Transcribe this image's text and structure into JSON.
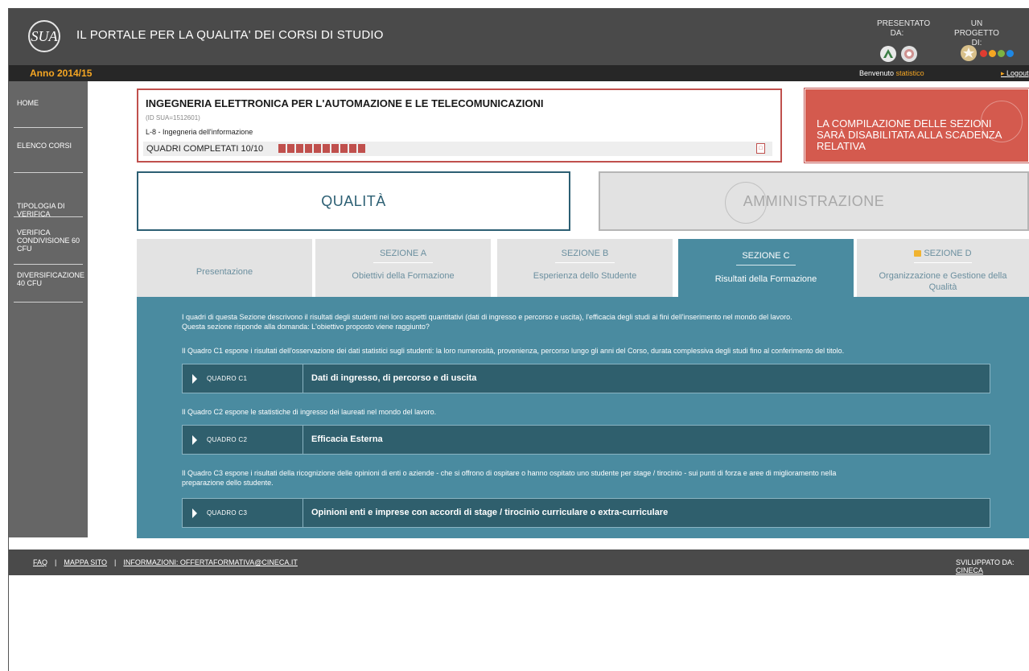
{
  "header": {
    "logo_text": "SUA",
    "title": "IL PORTALE PER LA QUALITA' DEI CORSI DI STUDIO",
    "presented_by": "PRESENTATO DA:",
    "project_of": "UN PROGETTO DI:",
    "anvur_label": "anvur"
  },
  "yearbar": {
    "year": "Anno 2014/15",
    "welcome": "Benvenuto",
    "user": "statistico",
    "logout": "Logout",
    "logout_arrow": "▸"
  },
  "sidebar": {
    "items": [
      {
        "label": "HOME"
      },
      {
        "label": "ELENCO CORSI"
      },
      {
        "label": "TIPOLOGIA DI VERIFICA"
      },
      {
        "label": "VERIFICA CONDIVISIONE 60 CFU"
      },
      {
        "label": "DIVERSIFICAZIONE 40 CFU"
      }
    ]
  },
  "course": {
    "title": "INGEGNERIA ELETTRONICA PER L'AUTOMAZIONE E LE TELECOMUNICAZIONI",
    "id": "(ID SUA=1512601)",
    "class": "L-8 - Ingegneria dell'informazione",
    "quadri": "QUADRI COMPLETATI 10/10",
    "quadri_completed": 10,
    "quadri_total": 10,
    "pdf_icon": "pdf-icon"
  },
  "warning": {
    "text": "LA COMPILAZIONE DELLE SEZIONI SARÀ DISABILITATA ALLA SCADENZA RELATIVA"
  },
  "big_tabs": {
    "qualita": "QUALITÀ",
    "amministrazione": "AMMINISTRAZIONE"
  },
  "section_tabs": [
    {
      "head": "",
      "sub": "Presentazione"
    },
    {
      "head": "SEZIONE A",
      "sub": "Obiettivi della Formazione"
    },
    {
      "head": "SEZIONE B",
      "sub": "Esperienza dello Studente"
    },
    {
      "head": "SEZIONE C",
      "sub": "Risultati della Formazione"
    },
    {
      "head": "SEZIONE D",
      "sub": "Organizzazione e Gestione della Qualità"
    }
  ],
  "content": {
    "intro_1": "I quadri di questa Sezione descrivono il risultati degli studenti nei loro aspetti quantitativi (dati di ingresso e percorso e uscita), l'efficacia degli studi ai fini dell'inserimento nel mondo del lavoro.",
    "intro_2": "Questa sezione risponde alla domanda: L'obiettivo proposto viene raggiunto?",
    "c1_desc": "Il Quadro C1 espone i risultati dell'osservazione dei dati statistici sugli studenti: la loro numerosità, provenienza, percorso lungo gli anni del Corso, durata complessiva degli studi fino al conferimento del titolo.",
    "c1_code": "QUADRO C1",
    "c1_title": "Dati di ingresso, di percorso e di uscita",
    "c2_desc": "Il Quadro C2 espone le statistiche di ingresso dei laureati nel mondo del lavoro.",
    "c2_code": "QUADRO C2",
    "c2_title": "Efficacia Esterna",
    "c3_desc_1": "Il Quadro C3 espone i risultati della ricognizione delle opinioni di enti o aziende - che si offrono di ospitare o hanno ospitato uno studente per stage / tirocinio - sui punti di forza e aree di miglioramento nella",
    "c3_desc_2": "preparazione dello studente.",
    "c3_code": "QUADRO C3",
    "c3_title": "Opinioni enti e imprese con accordi di stage / tirocinio curriculare o extra-curriculare"
  },
  "footer": {
    "faq": "FAQ",
    "sep": "|",
    "map": "MAPPA SITO",
    "info": "INFORMAZIONI: OFFERTAFORMATIVA@CINECA.IT",
    "dev_label": "SVILUPPATO DA:",
    "dev_link": "CINECA"
  },
  "colors": {
    "accent_red": "#c0504d",
    "teal": "#4a8ba0",
    "dark_teal": "#2f5f6d",
    "year_orange": "#f5a623"
  }
}
